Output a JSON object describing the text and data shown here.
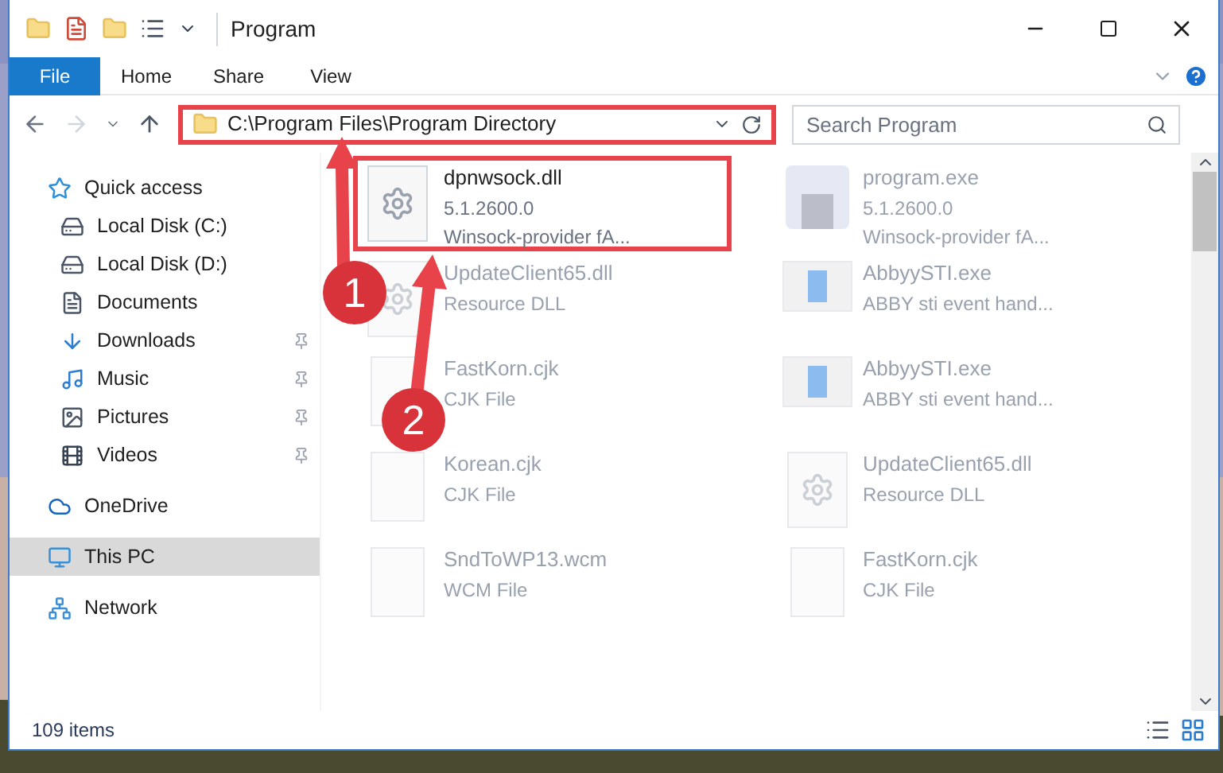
{
  "window": {
    "title": "Program"
  },
  "ribbon_tabs": [
    {
      "label": "File",
      "selected": true
    },
    {
      "label": "Home",
      "selected": false
    },
    {
      "label": "Share",
      "selected": false
    },
    {
      "label": "View",
      "selected": false
    }
  ],
  "address": {
    "path": "C:\\Program Files\\Program Directory",
    "highlighted": true
  },
  "search": {
    "placeholder": "Search Program"
  },
  "sidebar": {
    "items": [
      {
        "label": "Quick access",
        "kind": "group",
        "pinned": false,
        "selected": false
      },
      {
        "label": "Local Disk (C:)",
        "kind": "item",
        "pinned": false,
        "selected": false
      },
      {
        "label": "Local Disk (D:)",
        "kind": "item",
        "pinned": false,
        "selected": false
      },
      {
        "label": "Documents",
        "kind": "item",
        "pinned": false,
        "selected": false
      },
      {
        "label": "Downloads",
        "kind": "item",
        "pinned": true,
        "selected": false
      },
      {
        "label": "Music",
        "kind": "item",
        "pinned": true,
        "selected": false
      },
      {
        "label": "Pictures",
        "kind": "item",
        "pinned": true,
        "selected": false
      },
      {
        "label": "Videos",
        "kind": "item",
        "pinned": true,
        "selected": false
      },
      {
        "label": "OneDrive",
        "kind": "group",
        "pinned": false,
        "selected": false
      },
      {
        "label": "This PC",
        "kind": "group",
        "pinned": false,
        "selected": true
      },
      {
        "label": "Network",
        "kind": "group",
        "pinned": false,
        "selected": false
      }
    ]
  },
  "files": [
    {
      "name": "dpnwsock.dll",
      "details": [
        "5.1.2600.0",
        "Winsock-provider fA..."
      ],
      "kind": "dll",
      "blurred": false,
      "highlighted": true
    },
    {
      "name": "program.exe",
      "details": [
        "5.1.2600.0",
        "Winsock-provider fA..."
      ],
      "kind": "exe",
      "blurred": true,
      "highlighted": false
    },
    {
      "name": "UpdateClient65.dll",
      "details": [
        "Resource DLL"
      ],
      "kind": "dll",
      "blurred": true,
      "highlighted": false
    },
    {
      "name": "AbbyySTI.exe",
      "details": [
        "ABBY sti event hand..."
      ],
      "kind": "app",
      "blurred": true,
      "highlighted": false
    },
    {
      "name": "FastKorn.cjk",
      "details": [
        "CJK File"
      ],
      "kind": "blank",
      "blurred": true,
      "highlighted": false
    },
    {
      "name": "AbbyySTI.exe",
      "details": [
        "ABBY sti event hand..."
      ],
      "kind": "app",
      "blurred": true,
      "highlighted": false
    },
    {
      "name": "Korean.cjk",
      "details": [
        "CJK File"
      ],
      "kind": "blank",
      "blurred": true,
      "highlighted": false
    },
    {
      "name": "UpdateClient65.dll",
      "details": [
        "Resource DLL"
      ],
      "kind": "dll",
      "blurred": true,
      "highlighted": false
    },
    {
      "name": "SndToWP13.wcm",
      "details": [
        "WCM File"
      ],
      "kind": "blank",
      "blurred": true,
      "highlighted": false
    },
    {
      "name": "FastKorn.cjk",
      "details": [
        "CJK File"
      ],
      "kind": "blank",
      "blurred": true,
      "highlighted": false
    }
  ],
  "status_bar": {
    "count": "109 items"
  },
  "annotations": [
    {
      "number": "1"
    },
    {
      "number": "2"
    }
  ]
}
